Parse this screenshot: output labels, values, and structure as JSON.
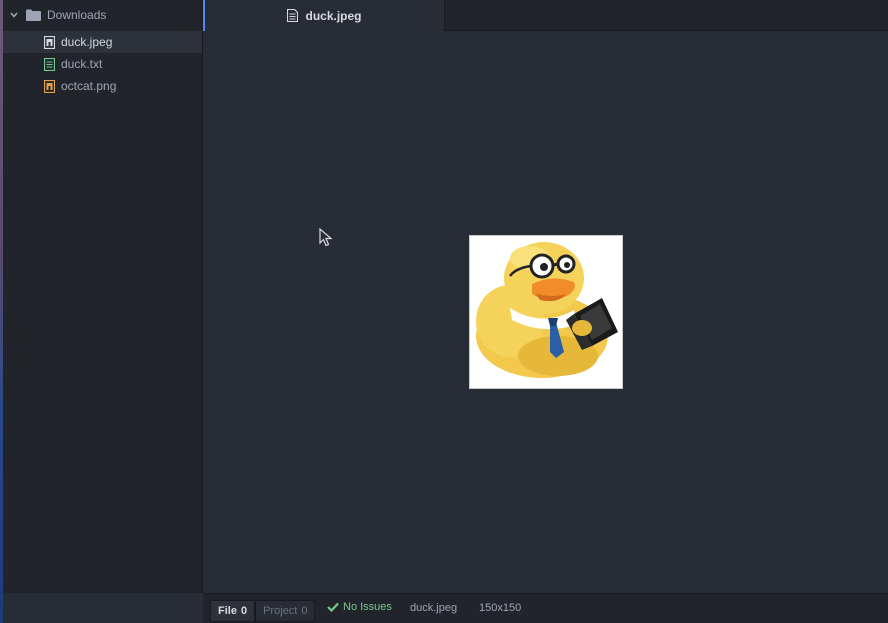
{
  "colors": {
    "accent": "#568af2",
    "success": "#73c990",
    "jpeg_icon": "#d7dae0",
    "txt_icon": "#73c990",
    "png_icon": "#e2a14f"
  },
  "sidebar": {
    "root": {
      "label": "Downloads",
      "icon": "folder-icon",
      "expanded": true
    },
    "items": [
      {
        "label": "duck.jpeg",
        "icon": "image-file-icon",
        "selected": true
      },
      {
        "label": "duck.txt",
        "icon": "text-file-icon",
        "selected": false
      },
      {
        "label": "octcat.png",
        "icon": "image-file-icon",
        "selected": false
      }
    ]
  },
  "tabs": [
    {
      "label": "duck.jpeg",
      "icon": "text-file-icon",
      "active": true
    }
  ],
  "editor": {
    "image_description_icon": "rubber-duck-image"
  },
  "statusbar": {
    "file_tab": {
      "label": "File",
      "count": "0"
    },
    "project_tab": {
      "label": "Project",
      "count": "0"
    },
    "issues": "No Issues",
    "filename": "duck.jpeg",
    "dimensions": "150x150"
  }
}
